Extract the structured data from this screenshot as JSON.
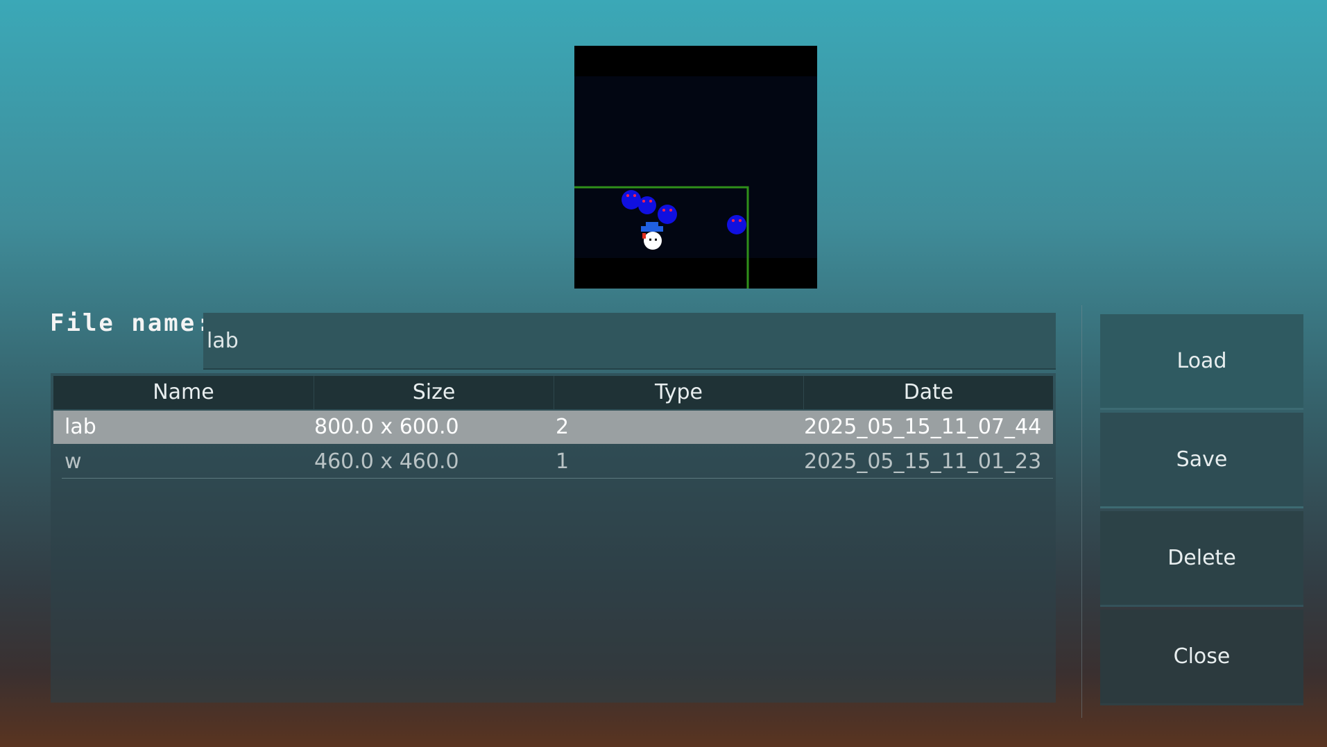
{
  "preview": {
    "colors": {
      "background": "#000000",
      "play_area": "#020612",
      "wall": "#2f8f1a",
      "enemy": "#1010e0",
      "enemy_eyes": "#ff2050",
      "player_hat": "#2060e0",
      "player_body": "#ffffff"
    }
  },
  "file_name": {
    "label": "File name:",
    "value": "lab"
  },
  "table": {
    "headers": {
      "name": "Name",
      "size": "Size",
      "type": "Type",
      "date": "Date"
    },
    "rows": [
      {
        "name": "lab",
        "size": "800.0 x 600.0",
        "type": "2",
        "date": "2025_05_15_11_07_44",
        "selected": true
      },
      {
        "name": "w",
        "size": "460.0 x 460.0",
        "type": "1",
        "date": "2025_05_15_11_01_23",
        "selected": false
      }
    ]
  },
  "buttons": {
    "load": "Load",
    "save": "Save",
    "delete": "Delete",
    "close": "Close"
  }
}
